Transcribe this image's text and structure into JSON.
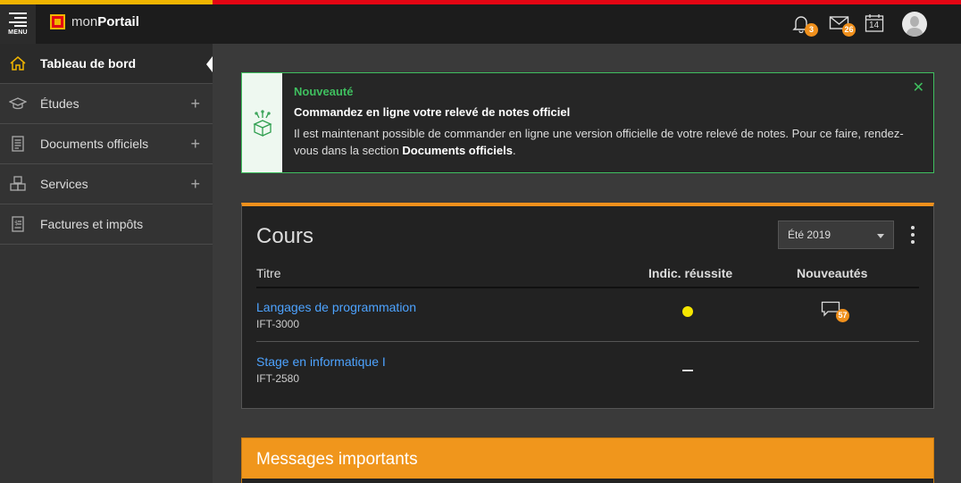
{
  "topbar": {
    "menu_label": "MENU",
    "brand_prefix": "mon",
    "brand_bold": "Portail",
    "notifications_count": "3",
    "messages_count": "26",
    "calendar_day": "14"
  },
  "sidebar": {
    "items": [
      {
        "label": "Tableau de bord",
        "icon": "home-icon",
        "active": true
      },
      {
        "label": "Études",
        "icon": "graduation-cap-icon",
        "expandable": true
      },
      {
        "label": "Documents officiels",
        "icon": "document-icon",
        "expandable": true
      },
      {
        "label": "Services",
        "icon": "boxes-icon",
        "expandable": true
      },
      {
        "label": "Factures et impôts",
        "icon": "invoice-icon"
      }
    ],
    "expand_symbol": "+"
  },
  "alert": {
    "title": "Nouveauté",
    "heading": "Commandez en ligne votre relevé de notes officiel",
    "text_before": "Il est maintenant possible de commander en ligne une version officielle de votre relevé de notes. Pour ce faire, rendez-vous dans la section ",
    "text_bold": "Documents officiels",
    "text_after": ".",
    "close_symbol": "✕",
    "accent_color": "#3fbf5f"
  },
  "courses": {
    "title": "Cours",
    "session": "Été 2019",
    "columns": {
      "title": "Titre",
      "indicator": "Indic. réussite",
      "news": "Nouveautés"
    },
    "rows": [
      {
        "name": "Langages de programmation",
        "code": "IFT-3000",
        "indicator": "yellow",
        "news_count": "57"
      },
      {
        "name": "Stage en informatique I",
        "code": "IFT-2580",
        "indicator": "none",
        "news_count": ""
      }
    ],
    "accent_color": "#f0901c"
  },
  "messages": {
    "title": "Messages importants"
  }
}
